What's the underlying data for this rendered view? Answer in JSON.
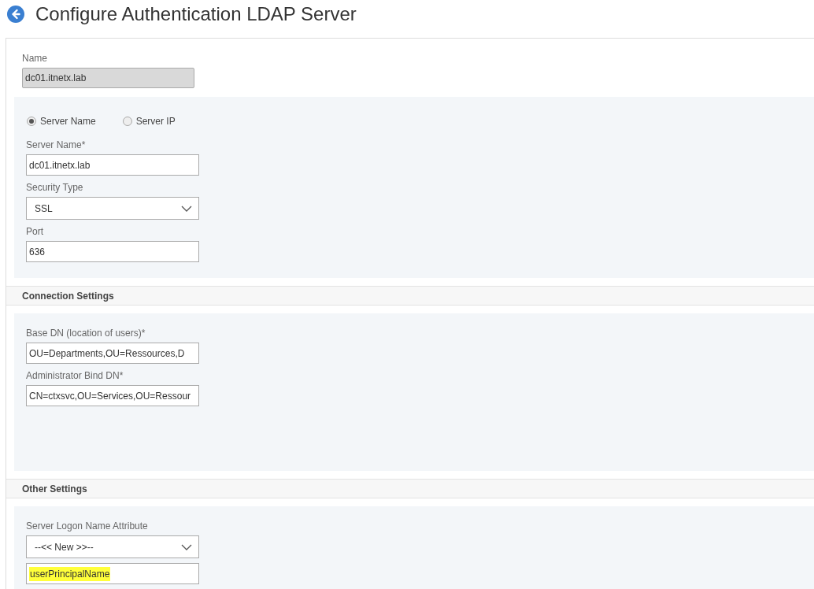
{
  "title": "Configure Authentication LDAP Server",
  "name_field": {
    "label": "Name",
    "value": "dc01.itnetx.lab",
    "disabled": true
  },
  "server_panel": {
    "radios": [
      {
        "label": "Server Name",
        "selected": true
      },
      {
        "label": "Server IP",
        "selected": false
      }
    ],
    "fields": [
      {
        "kind": "text",
        "label": "Server Name*",
        "value": "dc01.itnetx.lab"
      },
      {
        "kind": "select",
        "label": "Security Type",
        "value": "SSL"
      },
      {
        "kind": "text",
        "label": "Port",
        "value": "636"
      }
    ]
  },
  "sections": [
    {
      "title": "Connection Settings",
      "fields": [
        {
          "kind": "text",
          "label": "Base DN (location of users)*",
          "value": "OU=Departments,OU=Ressources,D"
        },
        {
          "kind": "text",
          "label": "Administrator Bind DN*",
          "value": "CN=ctxsvc,OU=Services,OU=Ressour"
        }
      ]
    },
    {
      "title": "Other Settings",
      "fields": [
        {
          "kind": "select",
          "label": "Server Logon Name Attribute",
          "value": "--<< New >>--"
        },
        {
          "kind": "text",
          "value": "userPrincipalName",
          "highlighted": true
        }
      ]
    }
  ]
}
